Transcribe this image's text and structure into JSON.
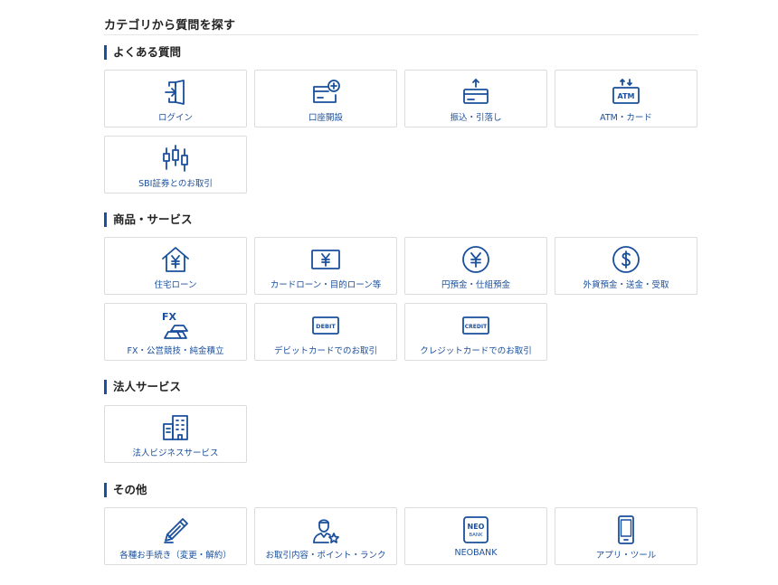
{
  "title": "カテゴリから質問を探す",
  "sections": [
    {
      "heading": "よくある質問",
      "items": [
        {
          "label": "ログイン",
          "icon": "login-door-icon"
        },
        {
          "label": "口座開設",
          "icon": "account-open-card-icon"
        },
        {
          "label": "振込・引落し",
          "icon": "transfer-card-icon"
        },
        {
          "label": "ATM・カード",
          "icon": "atm-icon"
        },
        {
          "label": "SBI証券とのお取引",
          "icon": "candlestick-chart-icon"
        }
      ]
    },
    {
      "heading": "商品・サービス",
      "items": [
        {
          "label": "住宅ローン",
          "icon": "house-yen-icon"
        },
        {
          "label": "カードローン・目的ローン等",
          "icon": "yen-bill-icon"
        },
        {
          "label": "円預金・仕組預金",
          "icon": "yen-coin-icon"
        },
        {
          "label": "外貨預金・送金・受取",
          "icon": "dollar-coin-icon"
        },
        {
          "label": "FX・公営競技・純金積立",
          "icon": "fx-gold-icon",
          "icon_text": "FX"
        },
        {
          "label": "デビットカードでのお取引",
          "icon": "debit-card-icon",
          "icon_text": "DEBIT"
        },
        {
          "label": "クレジットカードでのお取引",
          "icon": "credit-card-icon",
          "icon_text": "CREDIT"
        }
      ]
    },
    {
      "heading": "法人サービス",
      "items": [
        {
          "label": "法人ビジネスサービス",
          "icon": "office-building-icon"
        }
      ]
    },
    {
      "heading": "その他",
      "items": [
        {
          "label": "各種お手続き（変更・解約）",
          "icon": "pencil-icon"
        },
        {
          "label": "お取引内容・ポイント・ランク",
          "icon": "user-star-icon"
        },
        {
          "label": "NEOBANK",
          "icon": "neobank-logo-icon",
          "icon_text": "NEO",
          "icon_subtext": "BANK"
        },
        {
          "label": "アプリ・ツール",
          "icon": "smartphone-icon"
        }
      ]
    }
  ],
  "colors": {
    "accent": "#1a4f9c",
    "border": "#dcdcdc",
    "text": "#222222"
  }
}
